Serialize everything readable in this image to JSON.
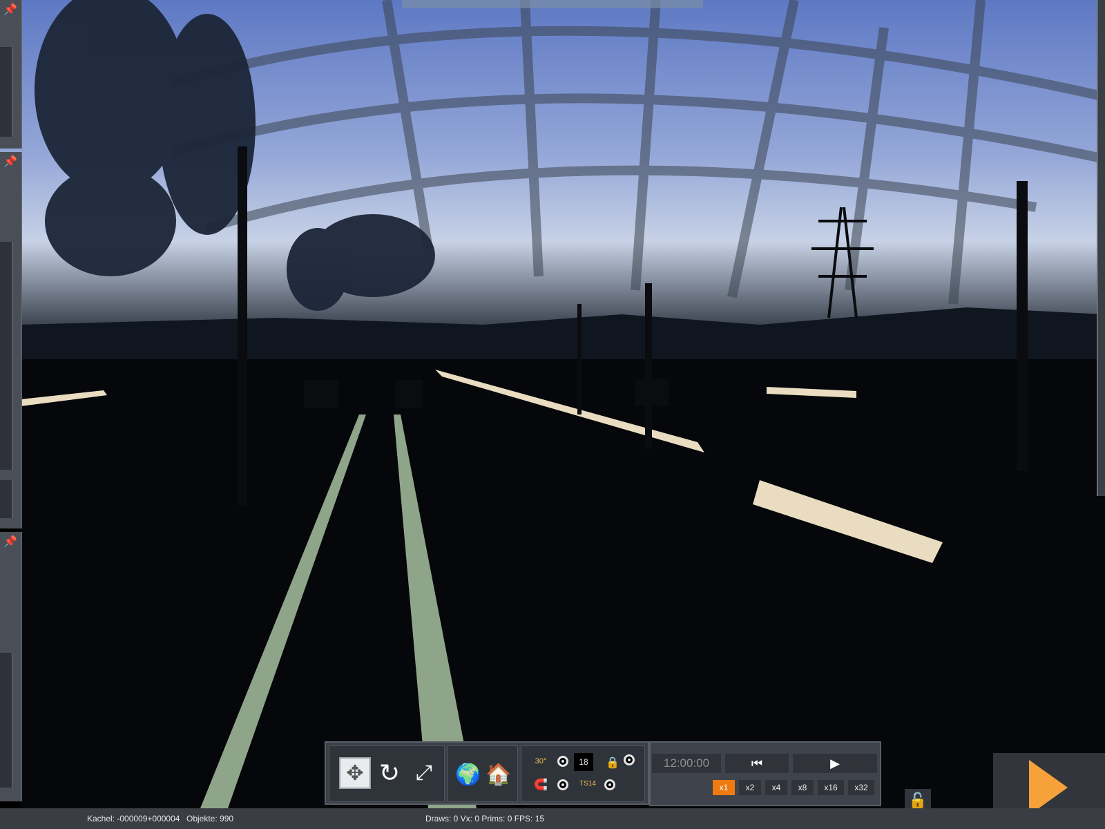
{
  "toolbar": {
    "move_label": "move",
    "rotate_label": "rotate",
    "scale_label": "scale",
    "globe_label": "world",
    "home_label": "home",
    "deg_label": "30°",
    "value_box": "18",
    "ts_label": "TS14"
  },
  "time_panel": {
    "time": "12:00:00",
    "speeds": [
      "x1",
      "x2",
      "x4",
      "x8",
      "x16",
      "x32"
    ],
    "active_speed": "x1"
  },
  "status": {
    "kachel": "Kachel: -000009+000004",
    "objekte": "Objekte: 990",
    "render": "Draws: 0 Vx: 0 Prims: 0 FPS: 15"
  },
  "colors": {
    "accent_orange": "#ef7a12",
    "play_orange": "#f6a13a",
    "rail_green": "#8fa58a",
    "platform_light": "#e9dcc0"
  },
  "icons": [
    "pin-icon",
    "move-icon",
    "rotate-icon",
    "scale-icon",
    "globe-icon",
    "home-icon",
    "angle-icon",
    "magnet-icon",
    "track-icon",
    "lock-icon",
    "play-icon",
    "skip-start-icon"
  ]
}
